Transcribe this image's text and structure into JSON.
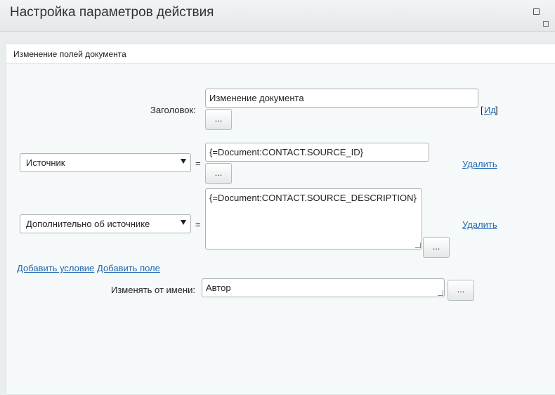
{
  "window": {
    "title": "Настройка параметров действия"
  },
  "panel": {
    "title": "Изменение полей документа"
  },
  "heading_field": {
    "label": "Заголовок:",
    "value": "Изменение документа",
    "dots": "...",
    "id_link_open": "[",
    "id_link": "Ид",
    "id_link_close": "]"
  },
  "conditions": [
    {
      "select": "Источник",
      "eq": "=",
      "value": "{=Document:CONTACT.SOURCE_ID}",
      "dots": "...",
      "delete": "Удалить"
    },
    {
      "select": "Дополнительно об источнике",
      "eq": "=",
      "value": "{=Document:CONTACT.SOURCE_DESCRIPTION}",
      "dots": "...",
      "delete": "Удалить"
    }
  ],
  "links": {
    "add_condition": "Добавить условие",
    "add_field": "Добавить поле"
  },
  "author_field": {
    "label": "Изменять от имени:",
    "value": "Автор",
    "dots": "..."
  }
}
